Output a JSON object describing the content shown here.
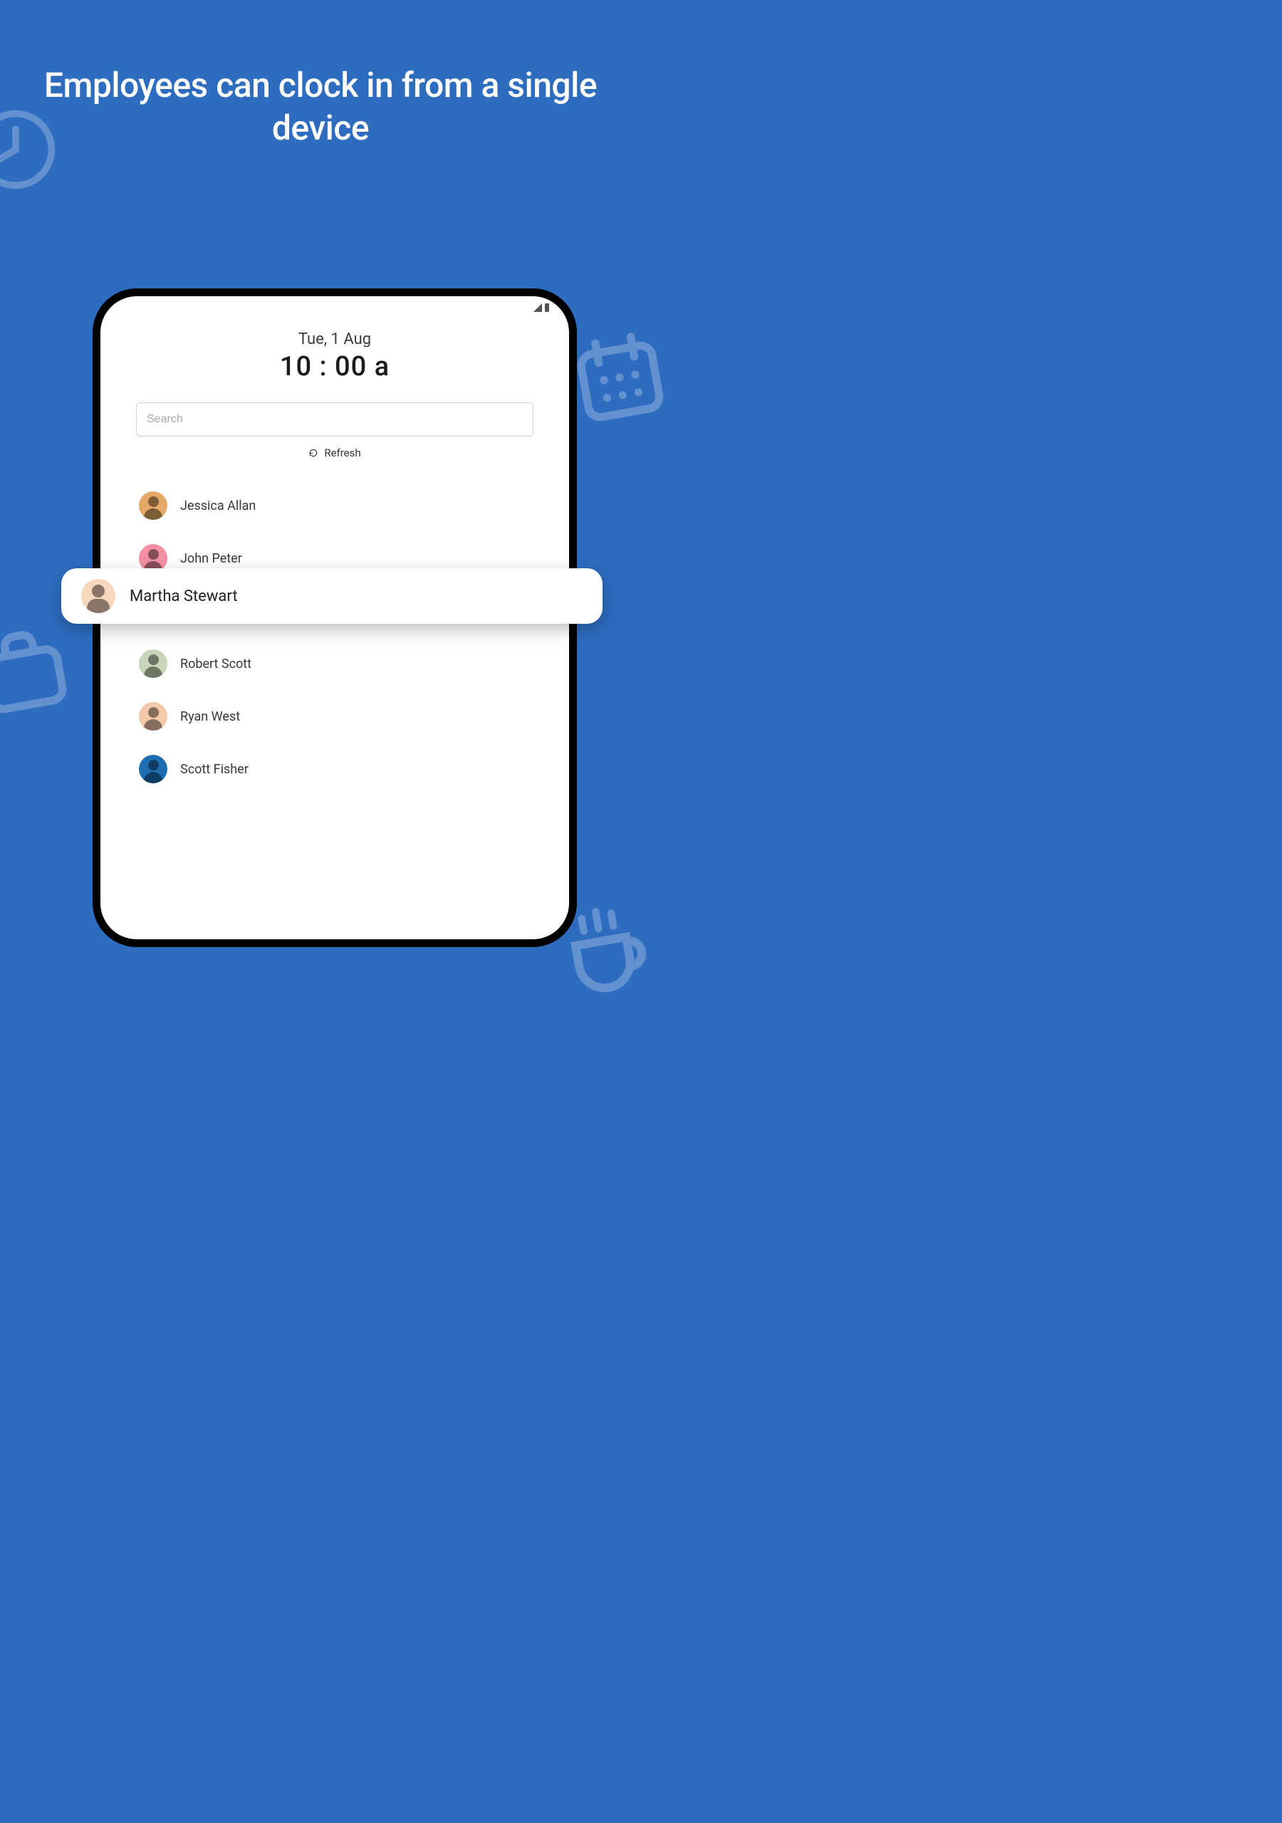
{
  "headline": "Employees can clock in from a single device",
  "header": {
    "date": "Tue, 1 Aug",
    "time": "10 : 00 a"
  },
  "search": {
    "placeholder": "Search",
    "value": ""
  },
  "refresh_label": "Refresh",
  "employees": [
    {
      "name": "Jessica Allan",
      "avatar_bg": "#e4a967"
    },
    {
      "name": "John Peter",
      "avatar_bg": "#f28fa3"
    },
    {
      "name": "Martha Stewart",
      "avatar_bg": "#f7d6bd",
      "highlighted": true
    },
    {
      "name": "Robert Scott",
      "avatar_bg": "#c9d5b8"
    },
    {
      "name": "Ryan West",
      "avatar_bg": "#f4c9a9"
    },
    {
      "name": "Scott Fisher",
      "avatar_bg": "#1d6db2"
    }
  ],
  "colors": {
    "background": "#2e6cbf",
    "device_border": "#000000"
  }
}
